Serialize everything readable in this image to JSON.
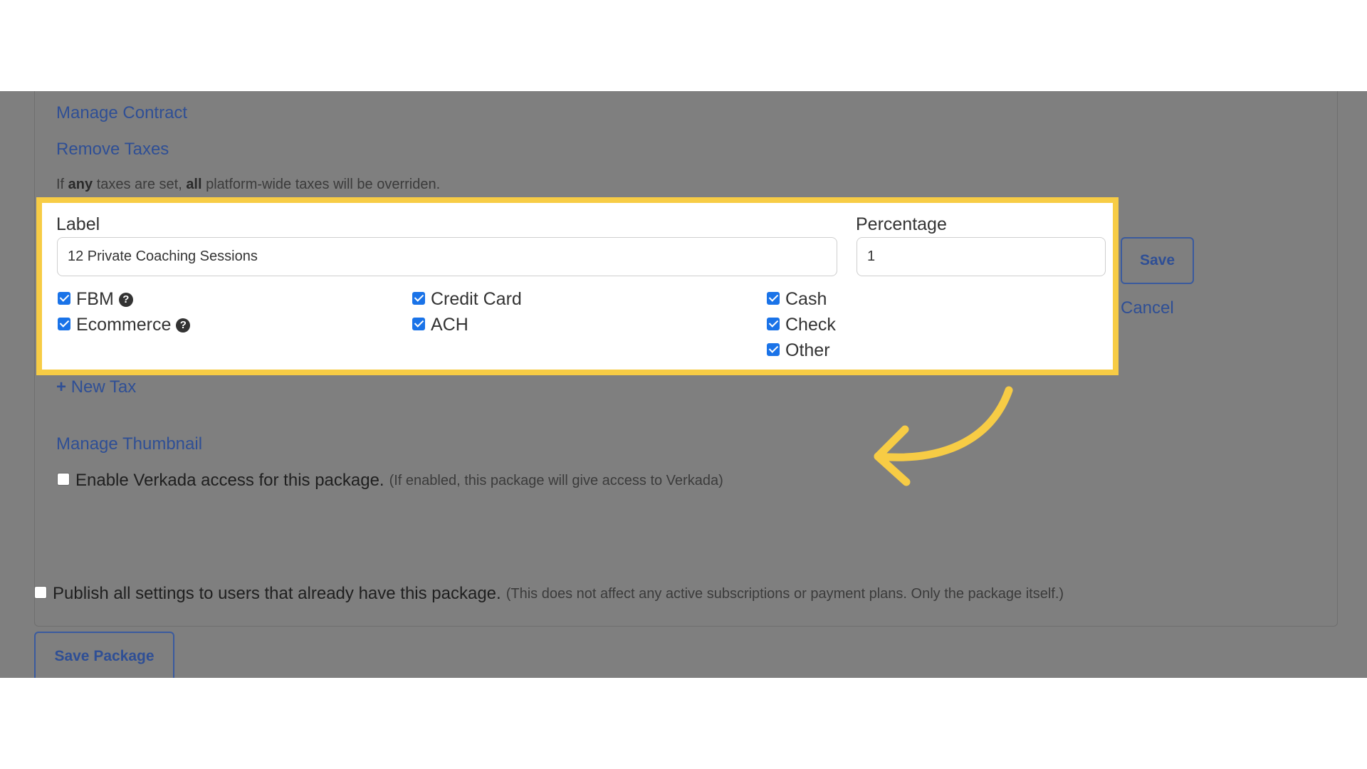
{
  "links": {
    "manage_contract": "Manage Contract",
    "remove_taxes": "Remove Taxes",
    "new_tax": "New Tax",
    "manage_thumbnail": "Manage Thumbnail",
    "cancel": "Cancel"
  },
  "tax_note": {
    "part1": "If ",
    "bold1": "any",
    "part2": " taxes are set, ",
    "bold2": "all",
    "part3": " platform-wide taxes will be overriden."
  },
  "tax_form": {
    "label_heading": "Label",
    "label_value": "12 Private Coaching Sessions",
    "percentage_heading": "Percentage",
    "percentage_value": "1",
    "save_label": "Save",
    "options": {
      "fbm": "FBM",
      "ecommerce": "Ecommerce",
      "credit_card": "Credit Card",
      "ach": "ACH",
      "cash": "Cash",
      "check": "Check",
      "other": "Other"
    },
    "help_glyph": "?"
  },
  "verkada": {
    "label": "Enable Verkada access for this package.",
    "hint": "(If enabled, this package will give access to Verkada)",
    "checked": false
  },
  "publish": {
    "label": "Publish all settings to users that already have this package.",
    "hint": "(This does not affect any active subscriptions or payment plans. Only the package itself.)",
    "checked": false
  },
  "save_package_label": "Save Package",
  "colors": {
    "highlight": "#f7cc45",
    "link": "#2f4f95",
    "checkbox": "#1a73e8",
    "overlay": "#7f7f7f"
  }
}
